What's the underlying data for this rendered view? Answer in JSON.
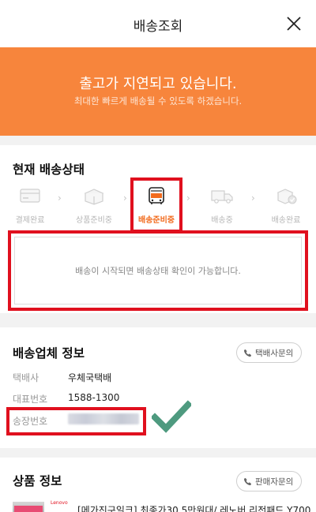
{
  "header": {
    "title": "배송조회",
    "close_icon": "close-icon"
  },
  "banner": {
    "title": "출고가 지연되고 있습니다.",
    "subtitle": "최대한 빠르게 배송될 수 있도록 하겠습니다.",
    "background_color": "#f7853c"
  },
  "delivery_status": {
    "title": "현재 배송상태",
    "steps": [
      {
        "label": "결제완료",
        "icon": "card-icon",
        "active": false
      },
      {
        "label": "상품준비중",
        "icon": "box-icon",
        "active": false
      },
      {
        "label": "배송준비중",
        "icon": "bus-icon",
        "active": true
      },
      {
        "label": "배송중",
        "icon": "truck-icon",
        "active": false
      },
      {
        "label": "배송완료",
        "icon": "box-check-icon",
        "active": false
      }
    ],
    "message": "배송이 시작되면 배송상태 확인이 가능합니다."
  },
  "carrier": {
    "title": "배송업체 정보",
    "inquiry_button": "택배사문의",
    "rows": [
      {
        "label": "택배사",
        "value": "우체국택배"
      },
      {
        "label": "대표번호",
        "value": "1588-1300"
      },
      {
        "label": "송장번호",
        "value": ""
      }
    ]
  },
  "product": {
    "title": "상품 정보",
    "inquiry_button": "판매자문의",
    "brand": "Lenovo",
    "name": "[메가진구일크] 최종가30.5만원대/ 레노버 리전패드 Y700"
  },
  "colors": {
    "accent": "#f26b1d",
    "highlight": "#e0101e",
    "check": "#4e9a7f"
  }
}
